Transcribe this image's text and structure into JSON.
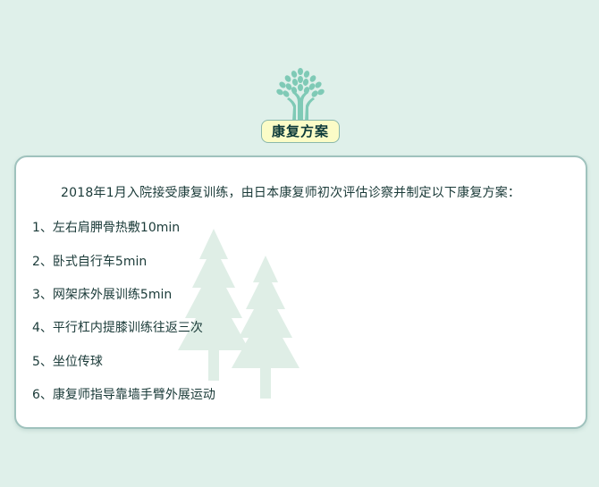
{
  "header": {
    "title": "康复方案",
    "icon": "tree-icon"
  },
  "card": {
    "intro": "2018年1月入院接受康复训练，由日本康复师初次评估诊察并制定以下康复方案：",
    "steps": [
      "1、左右肩胛骨热敷10min",
      "2、卧式自行车5min",
      "3、网架床外展训练5min",
      "4、平行杠内提膝训练往返三次",
      "5、坐位传球",
      "6、康复师指导靠墙手臂外展运动"
    ]
  },
  "colors": {
    "background": "#dff0ea",
    "badge": "#fbfcc7",
    "card_border": "#9fc2bd",
    "tree": "#7fcab6",
    "text": "#1a3a38"
  }
}
